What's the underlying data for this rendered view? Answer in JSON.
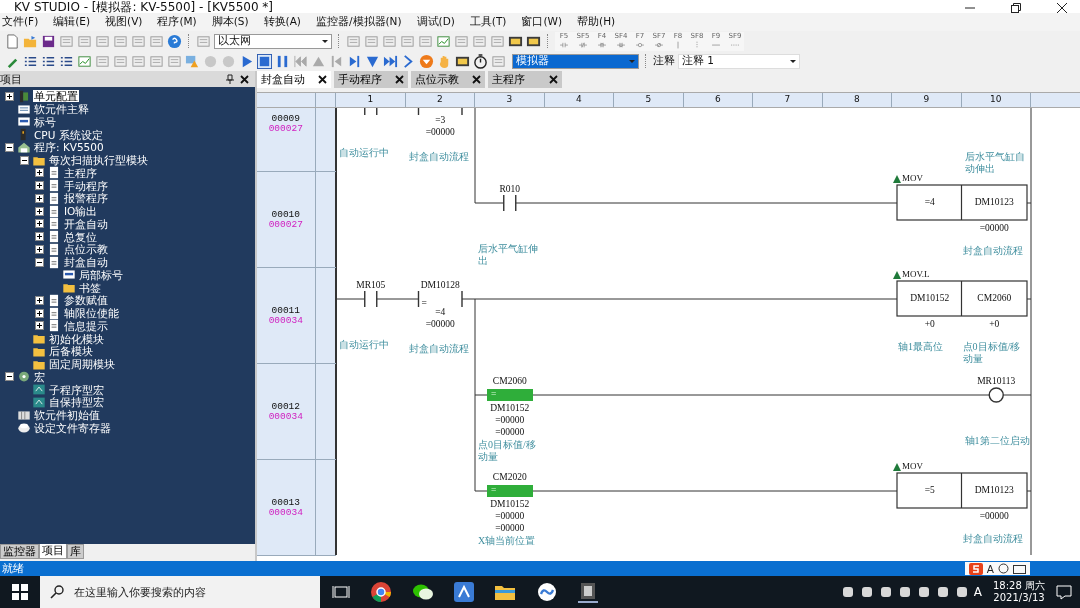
{
  "window": {
    "title": "KV STUDIO - [模拟器: KV-5500] - [KV5500 *]"
  },
  "menu": [
    "文件(F)",
    "编辑(E)",
    "视图(V)",
    "程序(M)",
    "脚本(S)",
    "转换(A)",
    "监控器/模拟器(N)",
    "调试(D)",
    "工具(T)",
    "窗口(W)",
    "帮助(H)"
  ],
  "toolbar": {
    "connection": "以太网",
    "mode": "模拟器",
    "comment_label": "注释",
    "comment_select": "注释 1",
    "ladder_keys": [
      {
        "key": "F5",
        "kind": "contact"
      },
      {
        "key": "SF5",
        "kind": "contact-nc"
      },
      {
        "key": "F4",
        "kind": "contact-up"
      },
      {
        "key": "SF4",
        "kind": "contact-down"
      },
      {
        "key": "F7",
        "kind": "coil"
      },
      {
        "key": "SF7",
        "kind": "coil-nc"
      },
      {
        "key": "F8",
        "kind": "vertical"
      },
      {
        "key": "SF8",
        "kind": "vertical-del"
      },
      {
        "key": "F9",
        "kind": "horizontal"
      },
      {
        "key": "SF9",
        "kind": "horizontal-del"
      }
    ]
  },
  "project_panel": {
    "title": "项目",
    "items": [
      {
        "label": "单元配置",
        "kind": "unit",
        "expanded": false,
        "selected": true
      },
      {
        "label": "软元件主释",
        "kind": "comment",
        "selected": false
      },
      {
        "label": "标号",
        "kind": "label",
        "selected": false
      },
      {
        "label": "CPU 系统设定",
        "kind": "cpu",
        "selected": false
      },
      {
        "label": "程序: KV5500",
        "kind": "program",
        "expanded": true,
        "selected": false,
        "children": [
          {
            "label": "每次扫描执行型模块",
            "kind": "folder",
            "expanded": true,
            "selected": false,
            "children": [
              {
                "label": "主程序",
                "kind": "module",
                "expanded": false,
                "selected": false
              },
              {
                "label": "手动程序",
                "kind": "module",
                "expanded": false,
                "selected": false
              },
              {
                "label": "报警程序",
                "kind": "module",
                "expanded": false,
                "selected": false
              },
              {
                "label": "IO输出",
                "kind": "module",
                "expanded": false,
                "selected": false
              },
              {
                "label": "开盒自动",
                "kind": "module",
                "expanded": false,
                "selected": false
              },
              {
                "label": "总复位",
                "kind": "module",
                "expanded": false,
                "selected": false
              },
              {
                "label": "点位示教",
                "kind": "module",
                "expanded": false,
                "selected": false
              },
              {
                "label": "封盒自动",
                "kind": "module",
                "expanded": true,
                "selected": false,
                "children": [
                  {
                    "label": "局部标号",
                    "kind": "label",
                    "selected": false
                  },
                  {
                    "label": "书签",
                    "kind": "folder",
                    "selected": false
                  }
                ]
              },
              {
                "label": "参数赋值",
                "kind": "module",
                "expanded": false,
                "selected": false
              },
              {
                "label": "轴限位使能",
                "kind": "module",
                "expanded": false,
                "selected": false
              },
              {
                "label": "信息提示",
                "kind": "module",
                "expanded": false,
                "selected": false
              }
            ]
          },
          {
            "label": "初始化模块",
            "kind": "folder",
            "selected": false
          },
          {
            "label": "后备模块",
            "kind": "folder",
            "selected": false
          },
          {
            "label": "固定周期模块",
            "kind": "folder",
            "selected": false
          }
        ]
      },
      {
        "label": "宏",
        "kind": "macro-group",
        "expanded": true,
        "selected": false,
        "children": [
          {
            "label": "子程序型宏",
            "kind": "macro",
            "selected": false
          },
          {
            "label": "自保持型宏",
            "kind": "macro",
            "selected": false
          }
        ]
      },
      {
        "label": "软元件初始值",
        "kind": "init",
        "selected": false
      },
      {
        "label": "设定文件寄存器",
        "kind": "file",
        "selected": false
      }
    ],
    "tabs": [
      {
        "label": "监控器",
        "selected": false
      },
      {
        "label": "项目",
        "selected": true
      },
      {
        "label": "库",
        "selected": false
      }
    ]
  },
  "document_tabs": [
    {
      "label": "封盒自动",
      "selected": true
    },
    {
      "label": "手动程序",
      "selected": false
    },
    {
      "label": "点位示教",
      "selected": false
    },
    {
      "label": "主程序",
      "selected": false
    }
  ],
  "ladder": {
    "columns": [
      "1",
      "2",
      "3",
      "4",
      "5",
      "6",
      "7",
      "8",
      "9",
      "10"
    ],
    "rungs": [
      {
        "number": "00009",
        "step": "000027",
        "elements": [
          {
            "kind": "contact",
            "comment": "自动运行中"
          },
          {
            "kind": "compare",
            "energized": false,
            "below": [
              "=3",
              "=00000"
            ],
            "comment": "封盒自动流程"
          },
          {
            "kind": "note",
            "comment": "后水平气缸自动伸出"
          }
        ]
      },
      {
        "number": "00010",
        "step": "000027",
        "elements": [
          {
            "kind": "contact",
            "device": "R010",
            "comment": "后水平气缸伸出"
          },
          {
            "kind": "instruction",
            "instruction": "MOV",
            "operands": [
              {
                "text": "=4"
              },
              {
                "text": "DM10123",
                "below": [
                  "=00000"
                ],
                "comment": "封盒自动流程"
              }
            ]
          }
        ]
      },
      {
        "number": "00011",
        "step": "000034",
        "elements": [
          {
            "kind": "contact",
            "device": "MR105",
            "comment": "自动运行中"
          },
          {
            "kind": "compare",
            "energized": false,
            "device": "DM10128",
            "symbol": "=",
            "below": [
              "=4",
              "=00000"
            ],
            "comment": "封盒自动流程"
          },
          {
            "kind": "instruction",
            "instruction": "MOV.L",
            "operands": [
              {
                "text": "DM10152",
                "below": [
                  "+0"
                ],
                "comment": "轴1最高位"
              },
              {
                "text": "CM2060",
                "below": [
                  "+0"
                ],
                "comment": "点0目标值/移动量"
              }
            ]
          }
        ]
      },
      {
        "number": "00012",
        "step": "000034",
        "elements": [
          {
            "kind": "compare",
            "energized": true,
            "device": "CM2060",
            "symbol": "=",
            "below": [
              "DM10152",
              "=00000",
              "=00000"
            ],
            "comment": "点0目标值/移动量"
          },
          {
            "kind": "coil",
            "device": "MR10113",
            "comment": "轴1第二位启动"
          }
        ]
      },
      {
        "number": "00013",
        "step": "000034",
        "elements": [
          {
            "kind": "compare",
            "energized": true,
            "device": "CM2020",
            "symbol": "=",
            "below": [
              "DM10152",
              "=00000",
              "=00000"
            ],
            "comment": "X轴当前位置"
          },
          {
            "kind": "instruction",
            "instruction": "MOV",
            "operands": [
              {
                "text": "=5"
              },
              {
                "text": "DM10123",
                "below": [
                  "=00000"
                ],
                "comment": "封盒自动流程"
              }
            ]
          }
        ]
      }
    ]
  },
  "status_bar": {
    "text": "就绪",
    "ime": "A"
  },
  "taskbar": {
    "search_placeholder": "在这里输入你要搜索的内容",
    "ime": "A",
    "time": "18:28 周六",
    "date": "2021/3/13"
  }
}
